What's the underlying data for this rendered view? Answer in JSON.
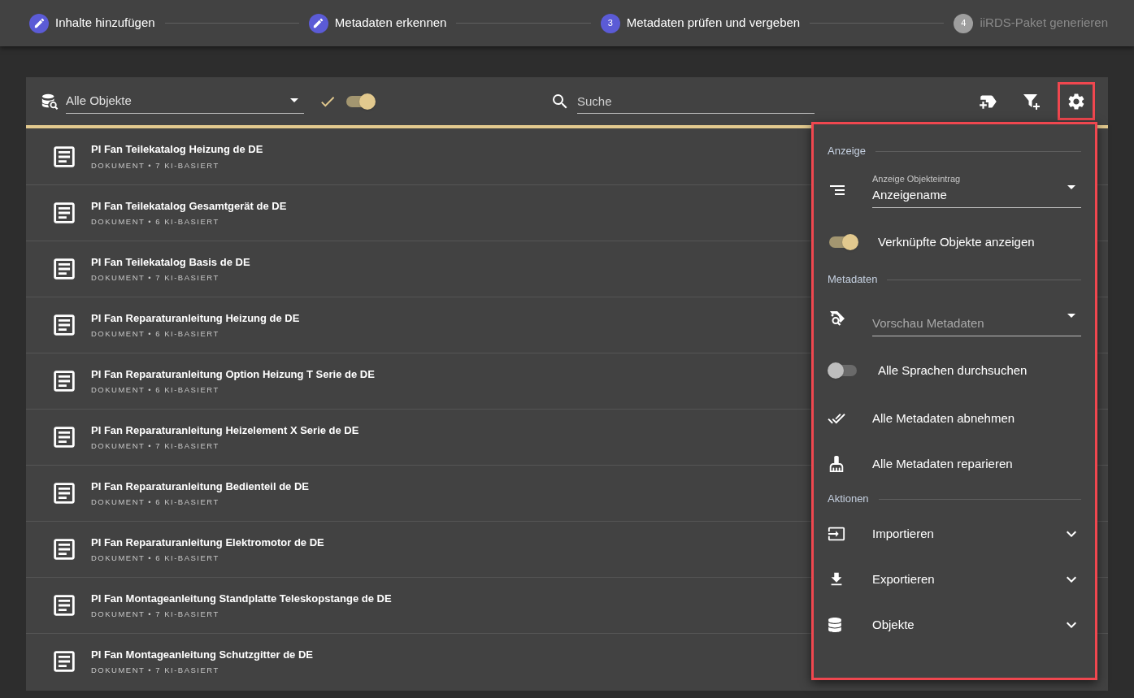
{
  "steps": [
    {
      "label": "Inhalte hinzufügen",
      "kind": "done"
    },
    {
      "label": "Metadaten erkennen",
      "kind": "done"
    },
    {
      "label": "Metadaten prüfen und vergeben",
      "number": "3",
      "kind": "active"
    },
    {
      "label": "iiRDS-Paket generieren",
      "number": "4",
      "kind": "pending"
    }
  ],
  "toolbar": {
    "object_filter": {
      "value": "Alle Objekte"
    },
    "approved_toggle": {
      "on": true
    },
    "search": {
      "placeholder": "Suche"
    },
    "settings_button": {
      "highlighted": true
    }
  },
  "rows": [
    {
      "title": "PI Fan Teilekatalog Heizung de DE",
      "subtitle": "DOKUMENT • 7 KI-BASIERT"
    },
    {
      "title": "PI Fan Teilekatalog Gesamtgerät de DE",
      "subtitle": "DOKUMENT • 6 KI-BASIERT"
    },
    {
      "title": "PI Fan Teilekatalog Basis de DE",
      "subtitle": "DOKUMENT • 7 KI-BASIERT"
    },
    {
      "title": "PI Fan Reparaturanleitung Heizung de DE",
      "subtitle": "DOKUMENT • 6 KI-BASIERT"
    },
    {
      "title": "PI Fan Reparaturanleitung Option Heizung T Serie de DE",
      "subtitle": "DOKUMENT • 6 KI-BASIERT"
    },
    {
      "title": "PI Fan Reparaturanleitung Heizelement X Serie de DE",
      "subtitle": "DOKUMENT • 7 KI-BASIERT"
    },
    {
      "title": "PI Fan Reparaturanleitung Bedienteil de DE",
      "subtitle": "DOKUMENT • 6 KI-BASIERT"
    },
    {
      "title": "PI Fan Reparaturanleitung Elektromotor de DE",
      "subtitle": "DOKUMENT • 6 KI-BASIERT"
    },
    {
      "title": "PI Fan Montageanleitung Standplatte Teleskopstange de DE",
      "subtitle": "DOKUMENT • 7 KI-BASIERT"
    },
    {
      "title": "PI Fan Montageanleitung Schutzgitter de DE",
      "subtitle": "DOKUMENT • 7 KI-BASIERT"
    }
  ],
  "settings_panel": {
    "highlighted": true,
    "items": [
      {
        "kind": "section",
        "label": "Anzeige"
      },
      {
        "kind": "select",
        "label": "Anzeige Objekteintrag",
        "value": "Anzeigename"
      },
      {
        "kind": "toggle",
        "label": "Verknüpfte Objekte anzeigen",
        "on": true
      },
      {
        "kind": "section",
        "label": "Metadaten"
      },
      {
        "kind": "select",
        "placeholder": "Vorschau Metadaten"
      },
      {
        "kind": "toggle",
        "label": "Alle Sprachen durchsuchen",
        "on": false
      },
      {
        "kind": "action",
        "label": "Alle Metadaten abnehmen"
      },
      {
        "kind": "action",
        "label": "Alle Metadaten reparieren"
      },
      {
        "kind": "section",
        "label": "Aktionen"
      },
      {
        "kind": "expand",
        "label": "Importieren",
        "expanded": false
      },
      {
        "kind": "expand",
        "label": "Exportieren",
        "expanded": false
      },
      {
        "kind": "expand",
        "label": "Objekte",
        "expanded": false
      }
    ]
  }
}
